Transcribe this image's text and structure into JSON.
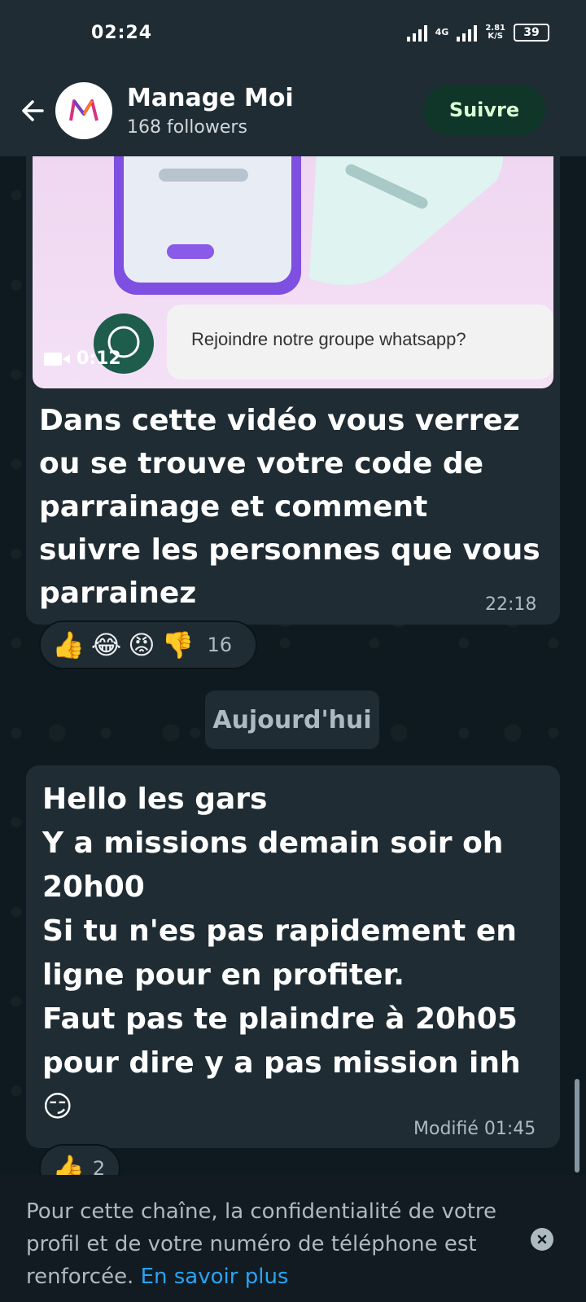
{
  "status_bar": {
    "time": "02:24",
    "network": "4G",
    "speed_value": "2.81",
    "speed_unit": "K/S",
    "battery": "39"
  },
  "header": {
    "channel_name": "Manage Moi",
    "followers": "168 followers",
    "follow_label": "Suivre"
  },
  "video_message": {
    "overlay_text": "Rejoindre notre groupe whatsapp?",
    "duration": "0:12",
    "text": "Dans cette vidéo vous verrez\nou se trouve votre code de\nparrainage et comment\nsuivre les personnes que vous\nparrainez",
    "time": "22:18",
    "reactions": [
      "👍",
      "😂",
      "😡",
      "👎"
    ],
    "reaction_count": "16"
  },
  "date_separator": "Aujourd'hui",
  "text_message": {
    "text": "Hello les gars\nY a missions demain soir oh\n20h00\nSi tu n'es pas rapidement en\nligne pour en profiter.\nFaut pas te plaindre à 20h05\npour dire y a pas mission inh😏",
    "time": "Modifié 01:45",
    "reaction": "👍",
    "reaction_count": "2"
  },
  "footer": {
    "notice": "Pour cette chaîne, la confidentialité de votre profil et de votre numéro de téléphone est renforcée. ",
    "link": "En savoir plus"
  }
}
